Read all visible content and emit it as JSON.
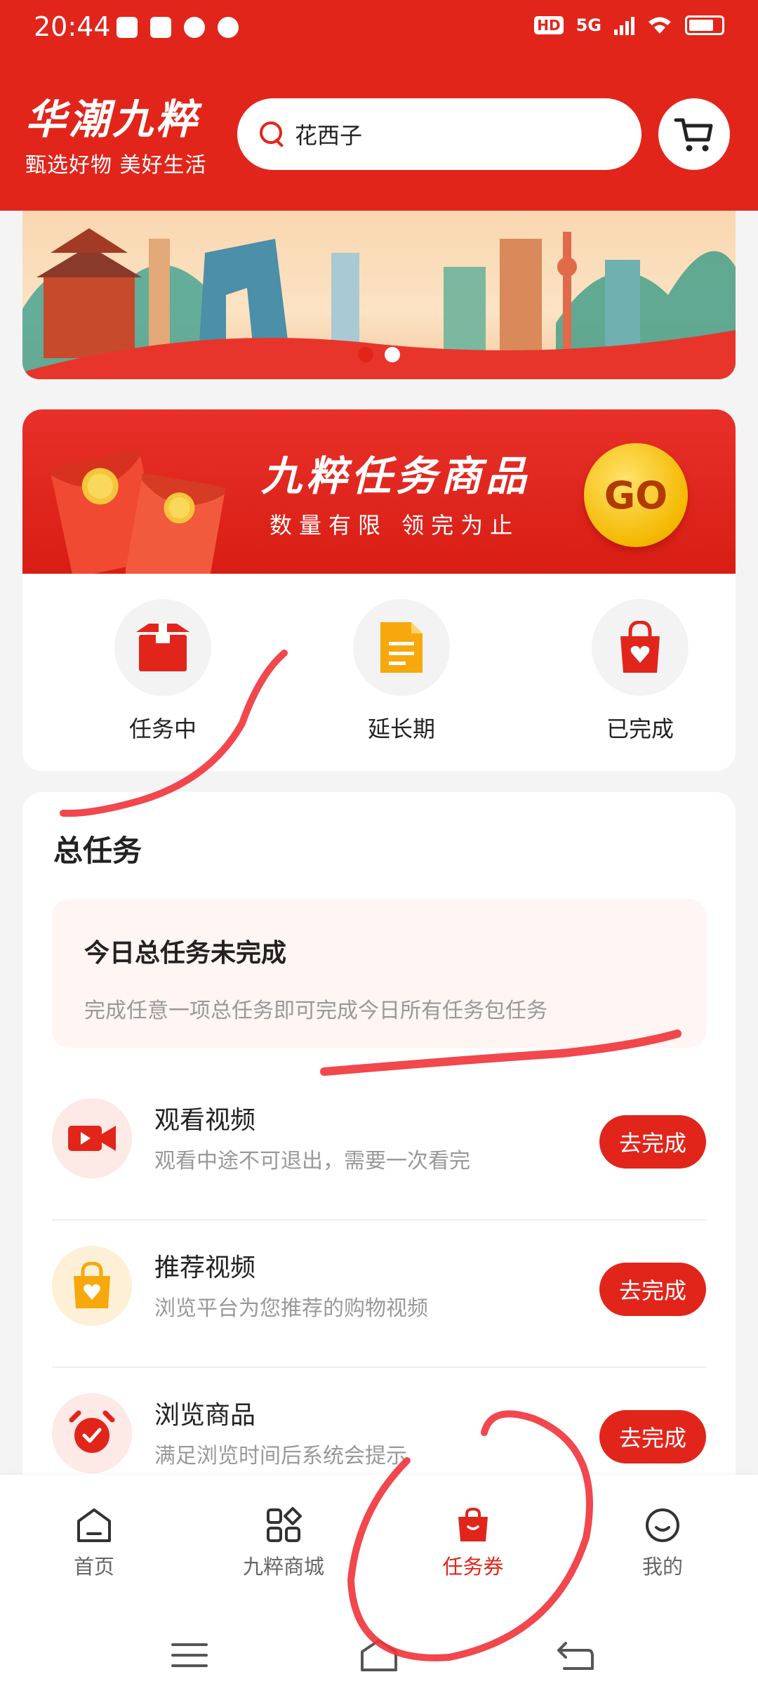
{
  "status_bar": {
    "time": "20:44",
    "network": "5G",
    "hd": "HD"
  },
  "header": {
    "brand_title": "华潮九粹",
    "brand_subtitle": "甄选好物 美好生活",
    "search_text": "花西子",
    "cart_icon": "cart-icon"
  },
  "banner": {
    "dots": 2,
    "active_dot": 1
  },
  "task_goods": {
    "title": "九粹任务商品",
    "subtitle": "数量有限 领完为止",
    "go_label": "GO",
    "categories": [
      {
        "label": "任务中",
        "icon": "box-icon"
      },
      {
        "label": "延长期",
        "icon": "document-icon"
      },
      {
        "label": "已完成",
        "icon": "heart-bag-icon"
      }
    ]
  },
  "main_tasks": {
    "section_title": "总任务",
    "notice_title": "今日总任务未完成",
    "notice_desc": "完成任意一项总任务即可完成今日所有任务包任务",
    "items": [
      {
        "title": "观看视频",
        "desc": "观看中途不可退出，需要一次看完",
        "button": "去完成",
        "icon": "video-camera-icon"
      },
      {
        "title": "推荐视频",
        "desc": "浏览平台为您推荐的购物视频",
        "button": "去完成",
        "icon": "shopping-bag-icon"
      },
      {
        "title": "浏览商品",
        "desc": "满足浏览时间后系统会提示",
        "button": "去完成",
        "icon": "alarm-clock-icon"
      }
    ]
  },
  "bottom_nav": {
    "items": [
      {
        "label": "首页",
        "icon": "home-icon"
      },
      {
        "label": "九粹商城",
        "icon": "grid-icon"
      },
      {
        "label": "任务券",
        "icon": "bag-icon"
      },
      {
        "label": "我的",
        "icon": "smile-icon"
      }
    ],
    "active": 2
  },
  "colors": {
    "brand_red": "#e1251b",
    "gold": "#f4b800",
    "annotation_red": "#f0333a"
  }
}
